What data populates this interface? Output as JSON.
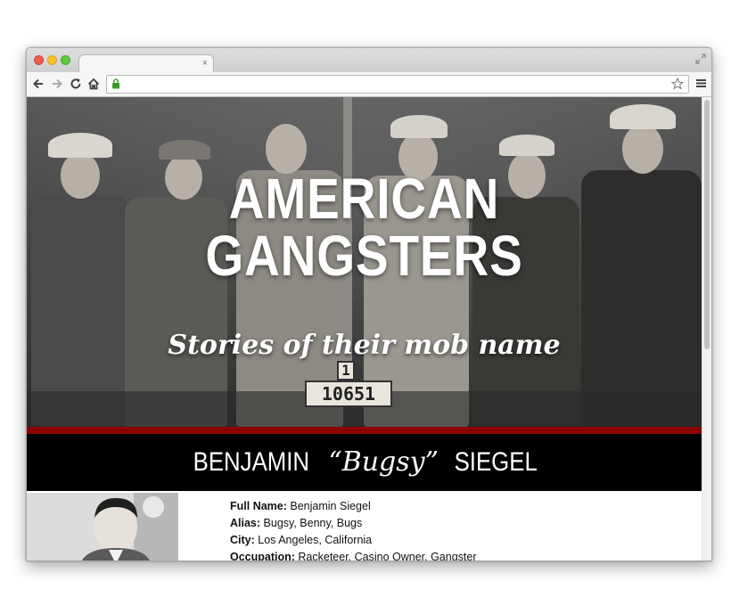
{
  "hero": {
    "title_line1": "AMERICAN",
    "title_line2": "GANGSTERS",
    "subtitle": "Stories of their mob name",
    "sign_top": "1",
    "sign_number": "10651"
  },
  "profile": {
    "name_first": "BENJAMIN",
    "name_nick": "“Bugsy”",
    "name_last": "SIEGEL",
    "fields": [
      {
        "label": "Full Name:",
        "value": "Benjamin Siegel"
      },
      {
        "label": "Alias:",
        "value": "Bugsy, Benny, Bugs"
      },
      {
        "label": "City:",
        "value": "Los Angeles, California"
      },
      {
        "label": "Occupation:",
        "value": "Racketeer, Casino Owner, Gangster"
      }
    ]
  },
  "browser": {
    "tab_close": "×",
    "icons": [
      "back-icon",
      "forward-icon",
      "reload-icon",
      "home-icon",
      "lock-icon",
      "star-icon",
      "menu-icon",
      "expand-icon"
    ]
  },
  "colors": {
    "accent_red": "#8b0000",
    "name_bar": "#000000"
  }
}
